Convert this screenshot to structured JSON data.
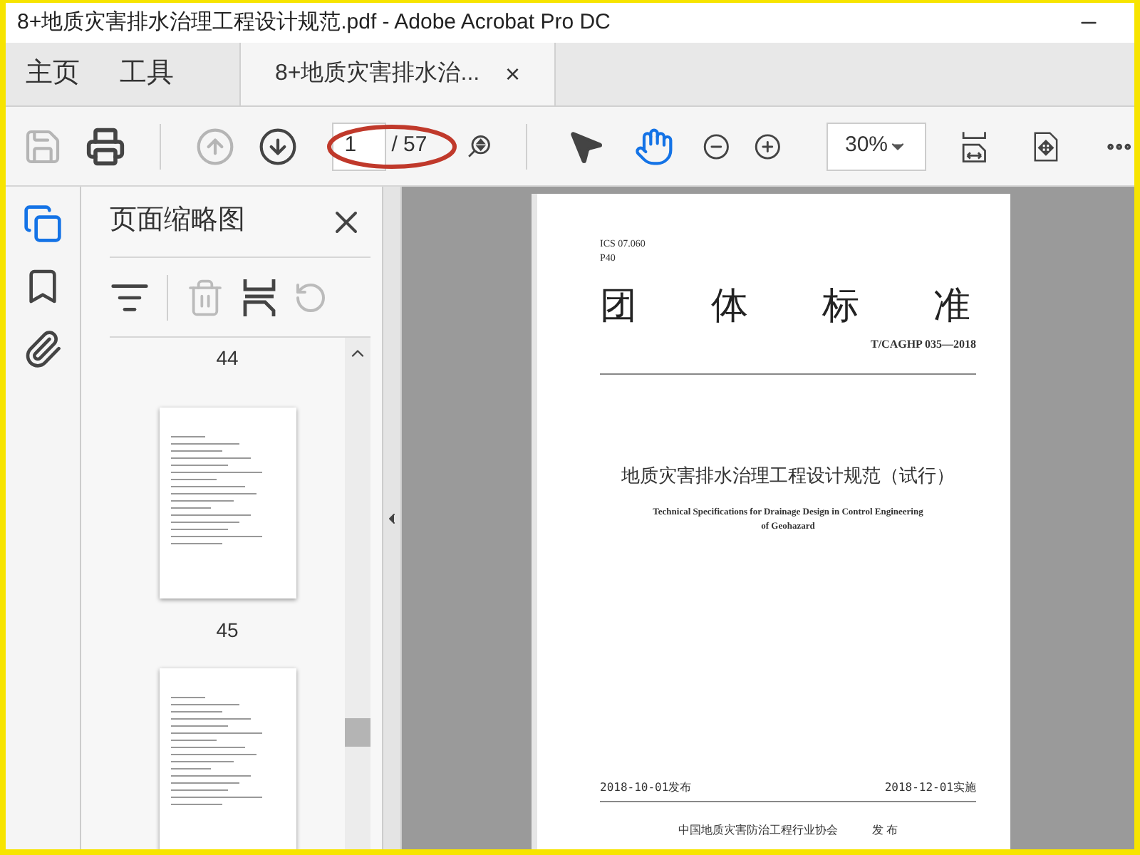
{
  "window": {
    "title": "8+地质灾害排水治理工程设计规范.pdf - Adobe Acrobat Pro DC"
  },
  "nav_tabs": [
    {
      "label": "主页",
      "selected": false
    },
    {
      "label": "工具",
      "selected": false
    }
  ],
  "document_tab": {
    "label": "8+地质灾害排水治...",
    "close": "×",
    "selected": true
  },
  "toolbar": {
    "tools": [
      {
        "kind": "save",
        "disabled": true
      },
      {
        "kind": "print",
        "disabled": false
      },
      {
        "kind": "prev",
        "disabled": true
      },
      {
        "kind": "next",
        "disabled": false
      }
    ],
    "page_number": "1",
    "page_count": "/ 57",
    "pointers": [
      {
        "kind": "select",
        "selected": false
      },
      {
        "kind": "hand",
        "selected": true
      }
    ],
    "zoom": "30%"
  },
  "side_rail": [
    {
      "kind": "pages",
      "selected": true
    },
    {
      "kind": "bookmarks",
      "selected": false
    },
    {
      "kind": "attachments",
      "selected": false
    }
  ],
  "thumbnail_panel": {
    "title": "页面缩略图",
    "page_labels": [
      "44",
      "45"
    ]
  },
  "page": {
    "codes": [
      "ICS 07.060",
      "P40"
    ],
    "heading_chars": [
      "团",
      "体",
      "标",
      "准"
    ],
    "standard_no": "T/CAGHP 035—2018",
    "title": "地质灾害排水治理工程设计规范（试行）",
    "subtitle_lines": [
      "Technical Specifications for Drainage Design in Control Engineering",
      "of Geohazard"
    ],
    "issue_date": "2018-10-01发布",
    "effective_date": "2018-12-01实施",
    "publisher": "中国地质灾害防治工程行业协会",
    "publisher_suffix": "发 布"
  }
}
